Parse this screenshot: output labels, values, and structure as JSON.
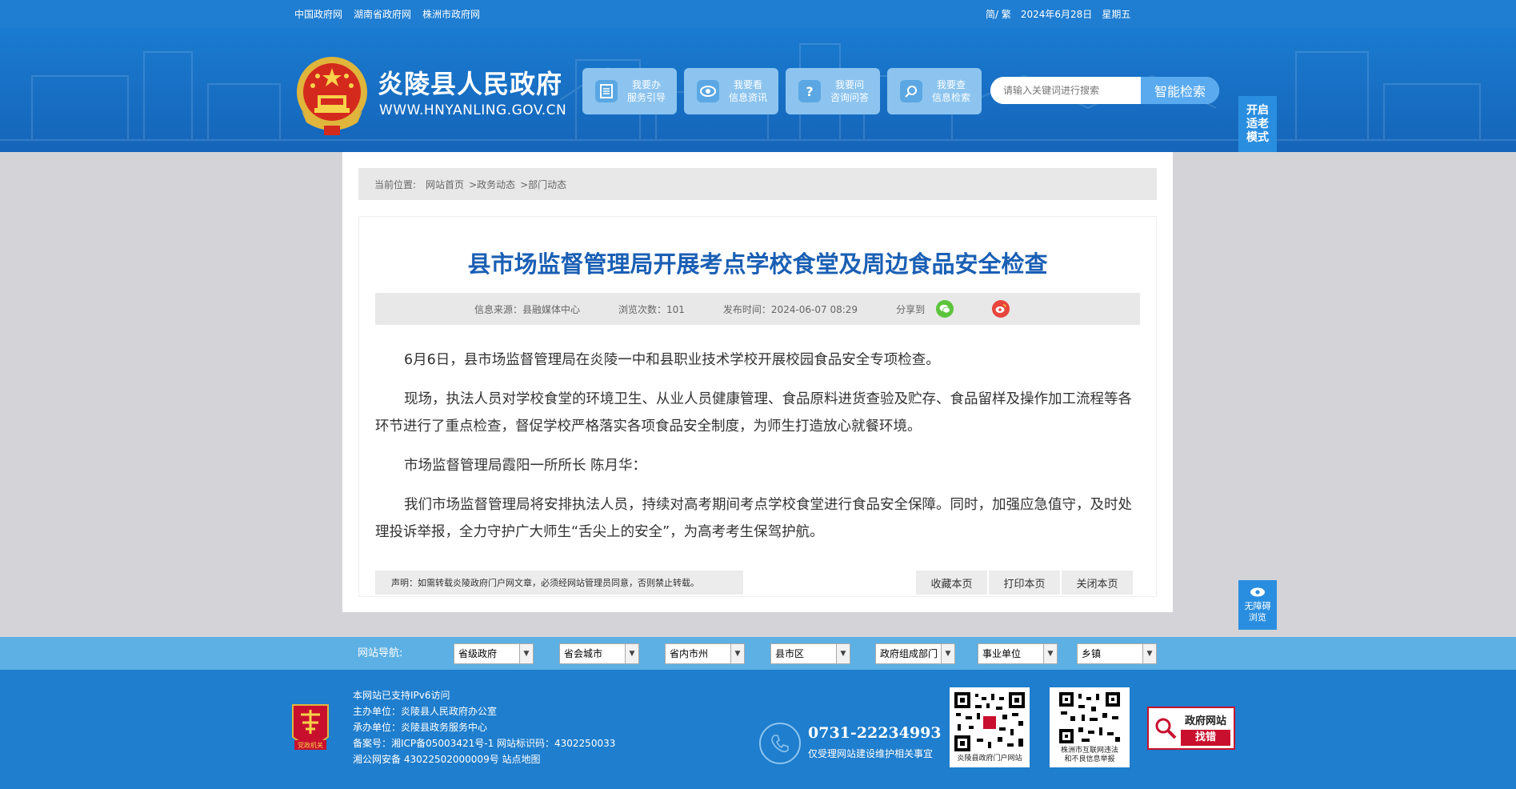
{
  "top_links": [
    "中国政府网",
    "湖南省政府网",
    "株洲市政府网"
  ],
  "top_right": {
    "lang": "简/ 繁",
    "date": "2024年6月28日",
    "weekday": "星期五"
  },
  "site": {
    "title": "炎陵县人民政府",
    "url": "WWW.HNYANLING.GOV.CN"
  },
  "quick_buttons": [
    {
      "line1": "我要办",
      "line2": "服务引导",
      "icon": "document-icon"
    },
    {
      "line1": "我要看",
      "line2": "信息资讯",
      "icon": "eye-icon"
    },
    {
      "line1": "我要问",
      "line2": "咨询问答",
      "icon": "question-icon"
    },
    {
      "line1": "我要查",
      "line2": "信息检索",
      "icon": "search-icon"
    }
  ],
  "search": {
    "placeholder": "请输入关键词进行搜索",
    "button": "智能检索"
  },
  "elder_mode": {
    "l1": "开启",
    "l2": "适老",
    "l3": "模式"
  },
  "breadcrumb": {
    "label": "当前位置:",
    "items": [
      "网站首页",
      ">政务动态",
      ">部门动态"
    ]
  },
  "article": {
    "title": "县市场监督管理局开展考点学校食堂及周边食品安全检查",
    "source": "信息来源：县融媒体中心",
    "views": "浏览次数：101",
    "published": "发布时间：2024-06-07 08:29",
    "share_label": "分享到",
    "paragraphs": [
      "6月6日，县市场监督管理局在炎陵一中和县职业技术学校开展校园食品安全专项检查。",
      "现场，执法人员对学校食堂的环境卫生、从业人员健康管理、食品原料进货查验及贮存、食品留样及操作加工流程等各环节进行了重点检查，督促学校严格落实各项食品安全制度，为师生打造放心就餐环境。",
      "市场监督管理局霞阳一所所长 陈月华：",
      "我们市场监督管理局将安排执法人员，持续对高考期间考点学校食堂进行食品安全保障。同时，加强应急值守，及时处理投诉举报，全力守护广大师生“舌尖上的安全”，为高考考生保驾护航。"
    ],
    "notice": "声明：如需转载炎陵政府门户网文章，必须经网站管理员同意，否则禁止转载。",
    "actions": [
      "收藏本页",
      "打印本页",
      "关闭本页"
    ]
  },
  "accessibility": {
    "l1": "无障碍",
    "l2": "浏览"
  },
  "site_nav": {
    "label": "网站导航:",
    "selects": [
      "省级政府",
      "省会城市",
      "省内市州",
      "县市区",
      "政府组成部门",
      "事业单位",
      "乡镇"
    ]
  },
  "footer": {
    "lines": [
      "本网站已支持IPv6访问",
      "主办单位：炎陵县人民政府办公室",
      "承办单位：炎陵县政务服务中心",
      "备案号：湘ICP备05003421号-1 网站标识码：4302250033",
      "湘公网安备 43022502000009号 站点地图"
    ],
    "phone": "0731-22234993",
    "phone_note": "仅受理网站建设维护相关事宜",
    "party_logo_text": "党政机关",
    "qr1_caption": "炎陵县政府门户网站",
    "qr2_caption_l1": "株洲市互联网违法",
    "qr2_caption_l2": "和不良信息举报",
    "find_error_l1": "政府网站",
    "find_error_l2": "找错"
  },
  "colors": {
    "primary": "#1f7ed1",
    "title": "#1a5fb4",
    "nav": "#5db0e3",
    "red": "#c8102e"
  }
}
